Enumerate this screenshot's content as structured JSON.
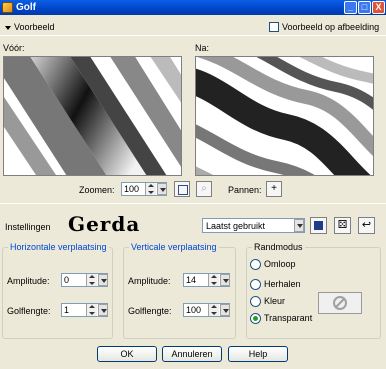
{
  "window": {
    "title": "Golf",
    "min_label": "_",
    "max_label": "□",
    "close_label": "X"
  },
  "preview": {
    "toggle_label": "Voorbeeld",
    "show_on_image_label": "Voorbeeld op afbeelding",
    "before_label": "Vóór:",
    "after_label": "Na:"
  },
  "zoom": {
    "label": "Zoomen:",
    "value": "100",
    "pan_label": "Pannen:"
  },
  "settings": {
    "label": "Instellingen",
    "logo_text": "Gerda",
    "preset_value": "Laatst gebruikt"
  },
  "horizontal": {
    "legend": "Horizontale verplaatsing",
    "amplitude_label": "Amplitude:",
    "amplitude_value": "0",
    "wavelength_label": "Golflengte:",
    "wavelength_value": "1"
  },
  "vertical": {
    "legend": "Verticale verplaatsing",
    "amplitude_label": "Amplitude:",
    "amplitude_value": "14",
    "wavelength_label": "Golflengte:",
    "wavelength_value": "100"
  },
  "edge_mode": {
    "legend": "Randmodus",
    "options": [
      {
        "label": "Omloop",
        "selected": false
      },
      {
        "label": "Herhalen",
        "selected": false
      },
      {
        "label": "Kleur",
        "selected": false
      },
      {
        "label": "Transparant",
        "selected": true
      }
    ]
  },
  "buttons": {
    "ok": "OK",
    "cancel": "Annuleren",
    "help": "Help"
  },
  "colors": {
    "title_bar": "#0045c8",
    "group_legend": "#0046d5",
    "dialog_bg": "#ece9d8"
  }
}
